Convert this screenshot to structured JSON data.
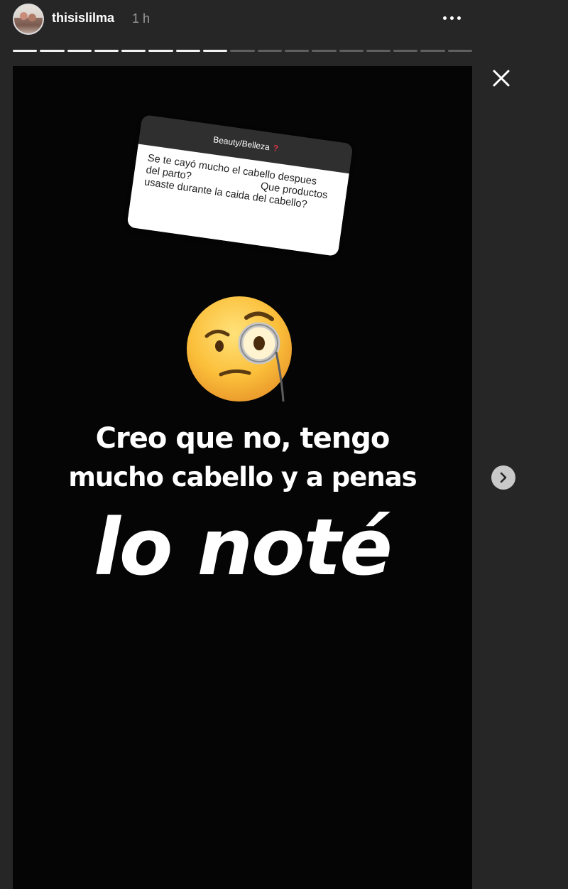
{
  "header": {
    "username": "thisislilma",
    "time": "1 h"
  },
  "progress": {
    "total": 17,
    "completed": 8
  },
  "question": {
    "title": "Beauty/Belleza",
    "title_mark": "?",
    "line1": "Se te cayó mucho el cabello despues",
    "line2": "del parto?",
    "line3": "Que productos",
    "line4": "usaste durante la caida del cabello?"
  },
  "answer": {
    "line1": "Creo que no, tengo",
    "line2": "mucho cabello y a penas",
    "line3": "lo noté"
  },
  "icons": {
    "more": "more-horizontal-icon",
    "close": "close-icon",
    "next": "chevron-right-icon",
    "emoji": "face-with-monocle-emoji"
  },
  "colors": {
    "background": "#262626",
    "story_background": "#050505",
    "question_mark": "#e8364a"
  }
}
